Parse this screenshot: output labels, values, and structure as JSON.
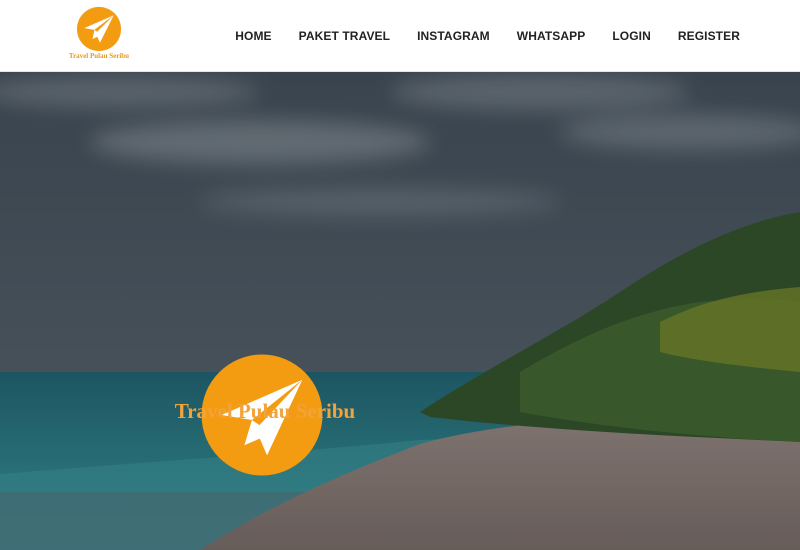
{
  "brand": {
    "name": "Travel Pulau Seribu",
    "logo_icon": "paper-plane-icon",
    "accent_color": "#f39c12"
  },
  "nav": {
    "items": [
      {
        "label": "HOME"
      },
      {
        "label": "PAKET TRAVEL"
      },
      {
        "label": "INSTAGRAM"
      },
      {
        "label": "WHATSAPP"
      },
      {
        "label": "LOGIN"
      },
      {
        "label": "REGISTER"
      }
    ]
  },
  "hero": {
    "title": "Travel Pulau Seribu",
    "logo_icon": "paper-plane-icon",
    "background": "beach-photo"
  }
}
